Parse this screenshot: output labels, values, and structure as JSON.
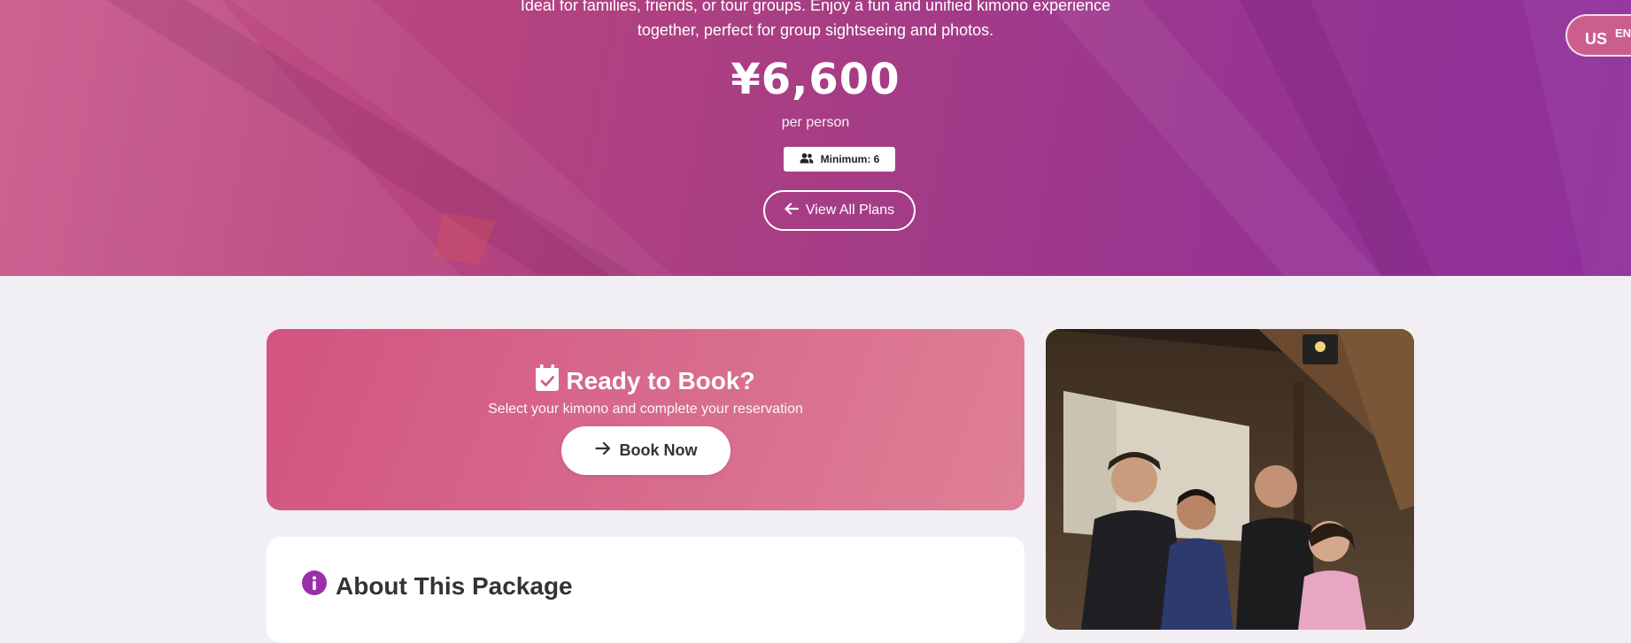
{
  "hero": {
    "description_line1": "Ideal for families, friends, or tour groups. Enjoy a fun and unified kimono experience",
    "description_line2": "together, perfect for group sightseeing and photos.",
    "price": "¥6,600",
    "per_person": "per person",
    "minimum_label": "Minimum: 6",
    "minimum_icon": "users-icon",
    "view_all_label": "View All Plans",
    "view_all_icon": "arrow-left-icon"
  },
  "language": {
    "flag": "US",
    "code": "EN"
  },
  "booking": {
    "title": "Ready to Book?",
    "title_icon": "calendar-check-icon",
    "subtitle": "Select your kimono and complete your reservation",
    "button_label": "Book Now",
    "button_icon": "arrow-right-icon"
  },
  "about": {
    "title": "About This Package",
    "title_icon": "info-circle-icon"
  },
  "colors": {
    "hero_start": "#c95a8c",
    "hero_end": "#8e2f9b",
    "book_card_start": "#d2547f",
    "book_card_end": "#df8096",
    "accent_purple": "#9b2fa8",
    "page_bg": "#f1eff4"
  }
}
